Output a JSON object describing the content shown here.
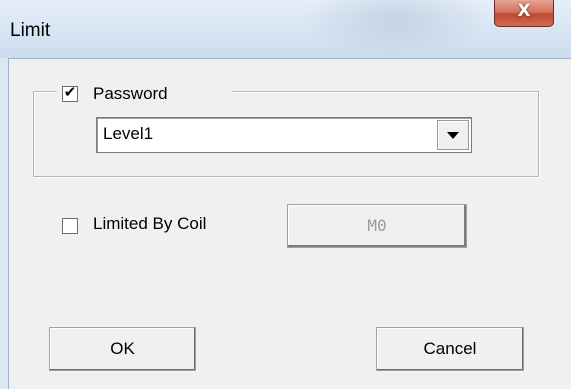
{
  "window": {
    "title": "Limit",
    "close_glyph": "X",
    "close_icon": "close-icon"
  },
  "password_group": {
    "checkbox_label": "Password",
    "checked": true,
    "check_glyph": "✔",
    "level_select": {
      "selected": "Level1",
      "arrow_icon": "chevron-down-icon"
    }
  },
  "coil": {
    "checkbox_label": "Limited By Coil",
    "checked": false,
    "address_button_label": "M0"
  },
  "buttons": {
    "ok_label": "OK",
    "cancel_label": "Cancel"
  }
}
